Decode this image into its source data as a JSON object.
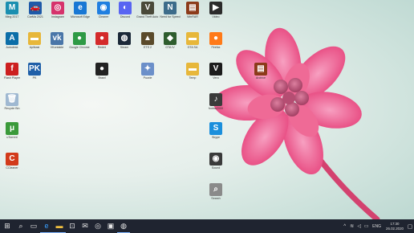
{
  "desktop": {
    "icons": [
      {
        "key": "malwarebytes",
        "label": "Ming 2017",
        "glyph": "M",
        "color": "#1a8fb0",
        "icon": "m-logo-icon"
      },
      {
        "key": "car",
        "label": "CarMa 2021",
        "glyph": "🚗",
        "color": "#1e5aa8",
        "icon": "car-icon"
      },
      {
        "key": "instagram",
        "label": "Instagram",
        "glyph": "◎",
        "color": "#d6336c",
        "icon": "instagram-icon"
      },
      {
        "key": "edge",
        "label": "Microsoft Edge",
        "glyph": "e",
        "color": "#1878d4",
        "icon": "edge-icon"
      },
      {
        "key": "cleaner",
        "label": "Cleaner",
        "glyph": "◉",
        "color": "#1f7fe0",
        "icon": "cleaner-icon"
      },
      {
        "key": "discord",
        "label": "Discord",
        "glyph": "◐",
        "color": "#5865f2",
        "icon": "discord-icon"
      },
      {
        "key": "gta5",
        "label": "Grand Theft Auto V",
        "glyph": "V",
        "color": "#4a4a3a",
        "icon": "gta-icon"
      },
      {
        "key": "nfs",
        "label": "Need for Speed",
        "glyph": "N",
        "color": "#3d6c8a",
        "icon": "game-icon"
      },
      {
        "key": "winrar",
        "label": "WinRAR",
        "glyph": "▤",
        "color": "#8c3b1a",
        "icon": "winrar-icon"
      },
      {
        "key": "video",
        "label": "Video",
        "glyph": "▶",
        "color": "#2b2b2b",
        "icon": "video-icon"
      },
      {
        "key": "autocad",
        "label": "Autodesk",
        "glyph": "A",
        "color": "#0b6ea8",
        "icon": "autodesk-icon"
      },
      {
        "key": "folder1",
        "label": "Aplikasi",
        "glyph": "▬",
        "color": "#e7b73a",
        "icon": "folder-icon"
      },
      {
        "key": "vk",
        "label": "VKontakte",
        "glyph": "vk",
        "color": "#4a76a8",
        "icon": "vk-icon"
      },
      {
        "key": "chrome",
        "label": "Google Chrome",
        "glyph": "●",
        "color": "#2e9a45",
        "icon": "chrome-icon"
      },
      {
        "key": "redapp",
        "label": "Redmi",
        "glyph": "●",
        "color": "#d42a2a",
        "icon": "app-icon"
      },
      {
        "key": "steam",
        "label": "Steam",
        "glyph": "◍",
        "color": "#1b2838",
        "icon": "steam-icon"
      },
      {
        "key": "ets",
        "label": "ETS 2",
        "glyph": "▲",
        "color": "#5a4a2a",
        "icon": "game-icon"
      },
      {
        "key": "gta4",
        "label": "GTA IV",
        "glyph": "◆",
        "color": "#2e5d2e",
        "icon": "game-icon"
      },
      {
        "key": "folder2",
        "label": "GTA SA",
        "glyph": "▬",
        "color": "#e7b73a",
        "icon": "folder-icon"
      },
      {
        "key": "firefox",
        "label": "Firefox",
        "glyph": "●",
        "color": "#ff7a18",
        "icon": "firefox-icon"
      },
      {
        "key": "flash",
        "label": "Flash Player",
        "glyph": "f",
        "color": "#cc1f1f",
        "icon": "flash-icon"
      },
      {
        "key": "pk",
        "label": "PK",
        "glyph": "PK",
        "color": "#1f5fa8",
        "icon": "pk-icon"
      },
      {
        "key": "ball",
        "label": "Brawl",
        "glyph": "●",
        "color": "#222",
        "icon": "ball-icon"
      },
      {
        "key": "puzzle",
        "label": "Puzzle",
        "glyph": "✦",
        "color": "#6b8fc9",
        "icon": "puzzle-icon"
      },
      {
        "key": "folder3",
        "label": "Temp",
        "glyph": "▬",
        "color": "#e7b73a",
        "icon": "folder-icon"
      },
      {
        "key": "v",
        "label": "Vero",
        "glyph": "V",
        "color": "#1c1c1c",
        "icon": "v-icon"
      },
      {
        "key": "winrar2",
        "label": "Archive",
        "glyph": "▤",
        "color": "#8c3b1a",
        "icon": "winrar-icon"
      },
      {
        "key": "recycle",
        "label": "Recycle Bin",
        "glyph": "🗑",
        "color": "#9fb8d1",
        "icon": "recycle-bin-icon"
      },
      {
        "key": "foobar",
        "label": "foobar2000",
        "glyph": "♪",
        "color": "#3a3a3a",
        "icon": "music-icon"
      },
      {
        "key": "utorrent",
        "label": "uTorrent",
        "glyph": "μ",
        "color": "#3a9a3a",
        "icon": "utorrent-icon"
      },
      {
        "key": "skype",
        "label": "Skype",
        "glyph": "S",
        "color": "#1b8fdc",
        "icon": "skype-icon"
      },
      {
        "key": "ccleaner",
        "label": "CCleaner",
        "glyph": "C",
        "color": "#d23a1a",
        "icon": "ccleaner-icon"
      },
      {
        "key": "speaker",
        "label": "Sound",
        "glyph": "◉",
        "color": "#3a3a3a",
        "icon": "speaker-icon"
      },
      {
        "key": "search",
        "label": "Search",
        "glyph": "⌕",
        "color": "#8a8a8a",
        "icon": "magnifier-icon"
      }
    ]
  },
  "taskbar": {
    "start_glyph": "⊞",
    "search_glyph": "⌕",
    "task_glyph": "▭",
    "edge_glyph": "e",
    "explorer_glyph": "▬",
    "store_glyph": "⊡",
    "mail_glyph": "✉",
    "media_glyph": "◎",
    "photos_glyph": "▣",
    "steam_glyph": "◍",
    "tray": {
      "up_glyph": "^",
      "wifi_glyph": "≋",
      "volume_glyph": "◁",
      "battery_glyph": "▭",
      "lang": "ENG",
      "time": "17:30",
      "date": "26.02.2020",
      "notification_glyph": "▢"
    }
  },
  "colors": {
    "taskbar": "#1f2430",
    "flower": "#ec4f86",
    "stem": "#d3426f"
  }
}
